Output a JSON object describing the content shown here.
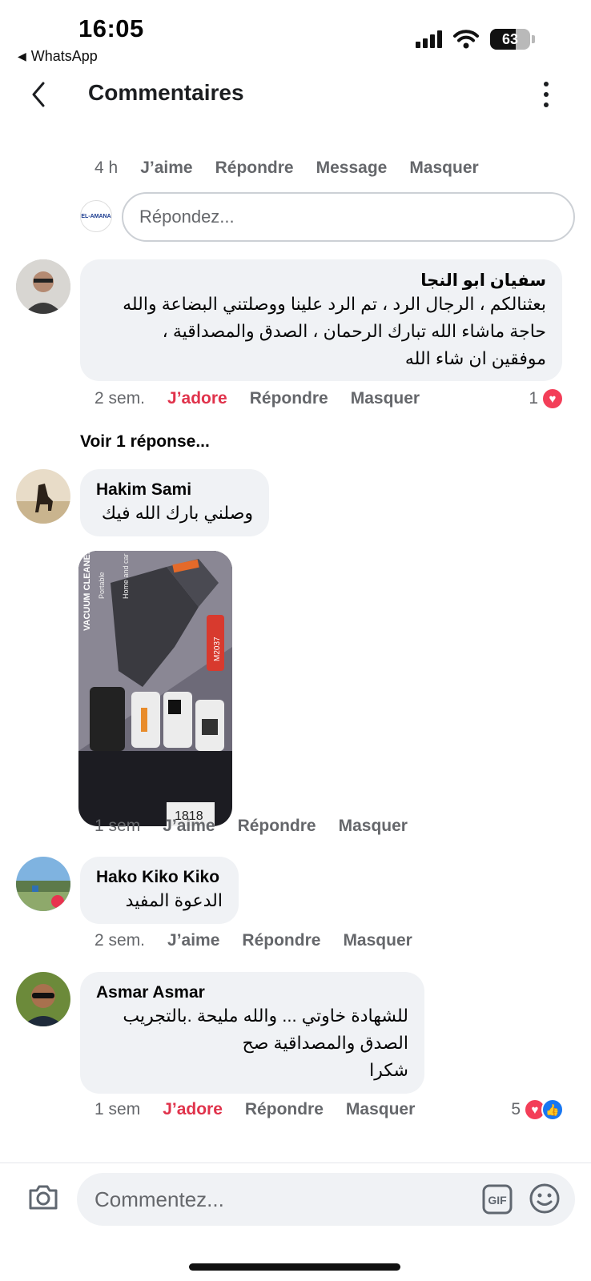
{
  "status_bar": {
    "time": "16:05",
    "back_app": "WhatsApp",
    "battery_level": "63"
  },
  "header": {
    "title": "Commentaires"
  },
  "top_meta": {
    "time": "4 h",
    "like": "J’aime",
    "reply": "Répondre",
    "message": "Message",
    "hide": "Masquer"
  },
  "reply_box": {
    "placeholder": "Répondez...",
    "logo_text": "EL-AMANA"
  },
  "comments": [
    {
      "author": "سفيان ابو النجا",
      "lines": [
        "بعثنالكم ، الرجال الرد ، تم الرد علينا ووصلتني البضاعة والله",
        "حاجة ماشاء الله تبارك الرحمان ، الصدق والمصداقية ،",
        "موفقين ان شاء الله"
      ],
      "time": "2 sem.",
      "like": "J’adore",
      "reply": "Répondre",
      "hide": "Masquer",
      "reaction_count": "1",
      "see_replies": "Voir 1 réponse..."
    },
    {
      "author": "Hakim Sami",
      "lines": [
        "وصلني بارك الله فيك"
      ],
      "photo_labels": [
        "VACUUM CLEANER",
        "Portable",
        "Home and car",
        "M2037",
        "1818"
      ],
      "time": "1 sem",
      "like": "J’aime",
      "reply": "Répondre",
      "hide": "Masquer"
    },
    {
      "author": "Hako Kiko Kiko",
      "lines": [
        "الدعوة المفيد"
      ],
      "time": "2 sem.",
      "like": "J’aime",
      "reply": "Répondre",
      "hide": "Masquer"
    },
    {
      "author": "Asmar Asmar",
      "lines": [
        "للشهادة خاوتي ... والله مليحة .بالتجريب",
        "الصدق والمصداقية صح",
        "شكرا"
      ],
      "time": "1 sem",
      "like": "J’adore",
      "reply": "Répondre",
      "hide": "Masquer",
      "reaction_count": "5"
    }
  ],
  "composer": {
    "placeholder": "Commentez...",
    "gif_label": "GIF"
  },
  "colors": {
    "adore": "#e0324b",
    "bubble": "#f0f2f5",
    "meta_gray": "#65676b",
    "like_blue": "#1877f2",
    "heart_red": "#f33e58"
  }
}
